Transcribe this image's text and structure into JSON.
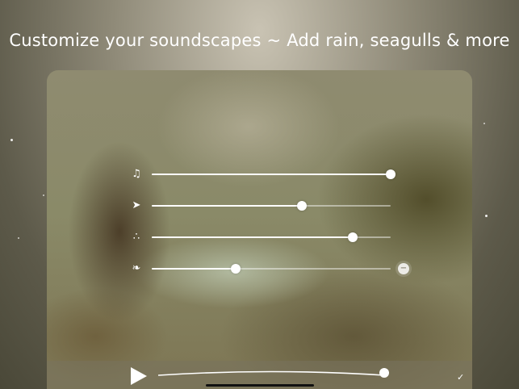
{
  "headline": "Customize your soundscapes ~ Add rain, seagulls & more",
  "mixer": {
    "channels": [
      {
        "icon": "music-note-icon",
        "glyph": "♫",
        "level": 1.0,
        "removable": false
      },
      {
        "icon": "wind-icon",
        "glyph": "➤",
        "level": 0.63,
        "removable": false
      },
      {
        "icon": "rain-drops-icon",
        "glyph": "∴",
        "level": 0.84,
        "removable": false
      },
      {
        "icon": "seagull-icon",
        "glyph": "❧",
        "level": 0.35,
        "removable": true
      }
    ]
  },
  "player": {
    "master_level": 1.0,
    "done_glyph": "✓"
  },
  "colors": {
    "accent": "#ffffff",
    "track": "rgba(255,255,255,0.45)"
  }
}
